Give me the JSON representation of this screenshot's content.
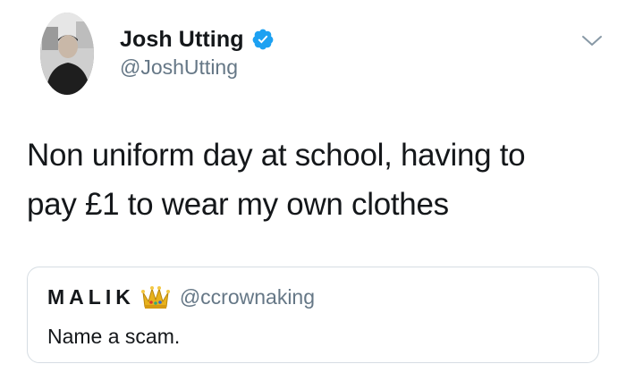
{
  "tweet": {
    "author": {
      "display_name": "Josh Utting",
      "handle": "@JoshUtting",
      "verified": true,
      "avatar_icon": "profile-photo"
    },
    "menu_icon": "chevron-down-icon",
    "text_lines": [
      "Non uniform day at school, having to",
      "pay £1 to wear my own clothes"
    ],
    "quoted_tweet": {
      "display_name": "MALIK",
      "name_emoji_icon": "crown-icon",
      "handle": "@ccrownaking",
      "text": "Name a scam."
    }
  },
  "colors": {
    "text_primary": "#14171a",
    "text_secondary": "#657786",
    "verified_blue": "#1da1f2",
    "border": "#d6dde3",
    "crown_gold": "#e8b21d"
  }
}
